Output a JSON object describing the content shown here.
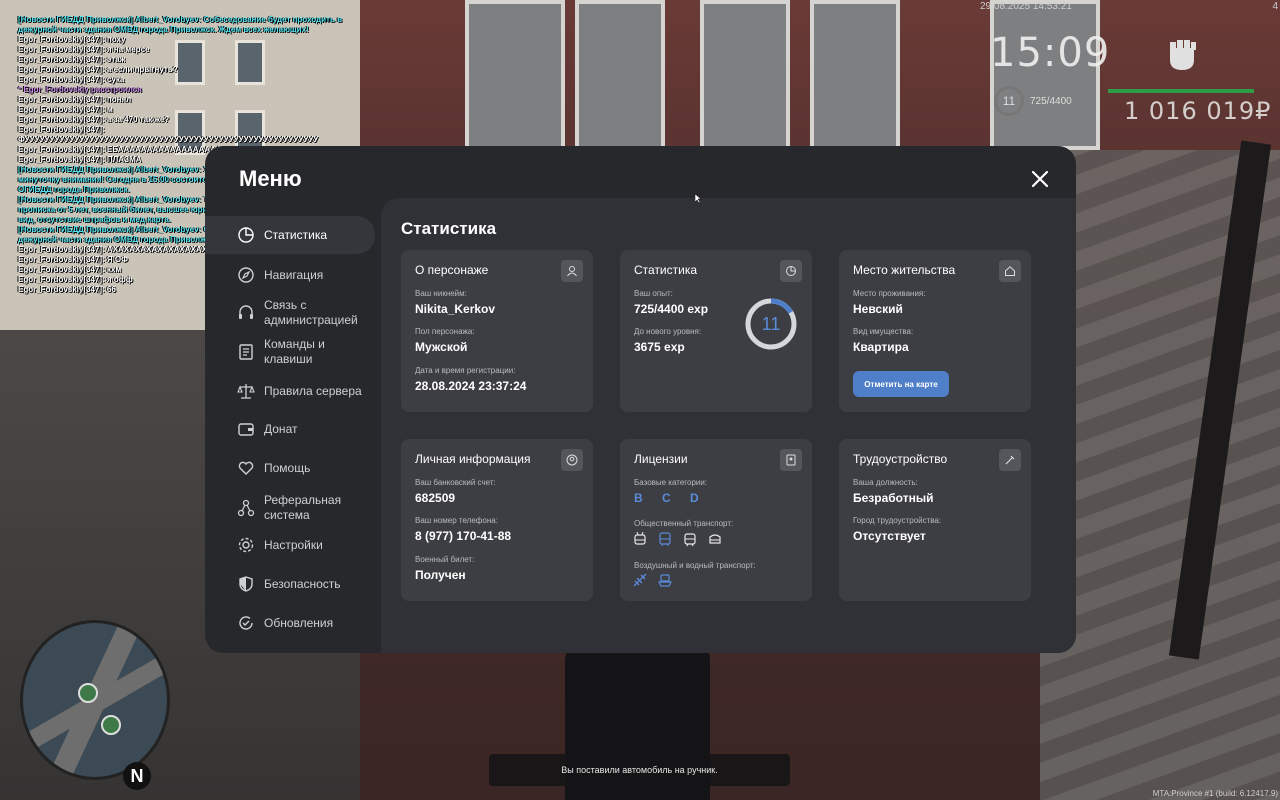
{
  "hud": {
    "datetime": "29.08.2025 14:53:21",
    "time": "15:09",
    "level": "11",
    "exp": "725/4400",
    "money": "1 016 019₽",
    "corner": "4"
  },
  "chat": [
    {
      "type": "news",
      "text": "[Новости ГИБДД Приволжск] Albert_Vorobyev: Собеседование будет проходить в дежурной части здания ОМВД города Приволжск. Ждем всех желающих!"
    },
    {
      "type": "normal",
      "text": "Egor_Fordovskiy[347]: поху"
    },
    {
      "type": "normal",
      "text": "Egor_Fordovskiy[347]: я на мерсе"
    },
    {
      "type": "normal",
      "text": "Egor_Fordovskiy[347]: этаж"
    },
    {
      "type": "normal",
      "text": "Egor_Fordovskiy[347]: а если прыгнуть?"
    },
    {
      "type": "normal",
      "text": "Egor_Fordovskiy[347]: сука"
    },
    {
      "type": "action",
      "text": "* Egor_Fordovskiy расстроился"
    },
    {
      "type": "normal",
      "text": "Egor_Fordovskiy[347]: понял"
    },
    {
      "type": "normal",
      "text": "Egor_Fordovskiy[347]: м"
    },
    {
      "type": "normal",
      "text": "Egor_Fordovskiy[347]: а за 470 так же?"
    },
    {
      "type": "normal",
      "text": "Egor_Fordovskiy[347]: ФУУУУУУУУУУУУУУУУУУУУУУУУУУУУУУУУУУУУУУУУУУУУУУУУУУУУУУУУУУУ"
    },
    {
      "type": "normal",
      "text": "Egor_Fordovskiy[347]: ЕБААААААААААААААААААААААТЬ"
    },
    {
      "type": "normal",
      "text": "Egor_Fordovskiy[347]: ПЛАЗМА"
    },
    {
      "type": "news",
      "text": "[Новости ГИБДД Приволжск] Albert_Vorobyev: Уважаемые жители республики, минуточку внимания! Сегодня в 15:00 состоится собеседование в УК ДПС ОГИБДД города Приволжск."
    },
    {
      "type": "news",
      "text": "[Новости ГИБДД Приволжск] Albert_Vorobyev: Требования к кандидатам: прописка от 5 лет, военный билет, высшее юридическое образование, опрятный вид, отсутствие штрафов и мед.карта."
    },
    {
      "type": "news",
      "text": "[Новости ГИБДД Приволжск] Albert_Vorobyev: Собеседование будет проходить в дежурной части здания ОМВД города Приволжск. Ждем всех желающих!"
    },
    {
      "type": "normal",
      "text": "Egor_Fordovskiy[347]: АХАХАХАХАХАХАХАХАХАХАХАХАХАХАХАХАХАХАХ"
    },
    {
      "type": "normal",
      "text": "Egor_Fordovskiy[347]: Я ОФ"
    },
    {
      "type": "normal",
      "text": "Egor_Fordovskiy[347]: кхм"
    },
    {
      "type": "normal",
      "text": "Egor_Fordovskiy[347]: я офф"
    },
    {
      "type": "normal",
      "text": "Egor_Fordovskiy[347]: 66"
    }
  ],
  "menu": {
    "title": "Меню",
    "sidebar": [
      {
        "label": "Статистика",
        "icon": "pie-chart-icon",
        "active": true
      },
      {
        "label": "Навигация",
        "icon": "compass-icon"
      },
      {
        "label": "Связь с администрацией",
        "icon": "headset-icon"
      },
      {
        "label": "Команды и клавиши",
        "icon": "document-icon"
      },
      {
        "label": "Правила сервера",
        "icon": "scales-icon"
      },
      {
        "label": "Донат",
        "icon": "wallet-icon"
      },
      {
        "label": "Помощь",
        "icon": "heart-hand-icon"
      },
      {
        "label": "Реферальная система",
        "icon": "network-icon"
      },
      {
        "label": "Настройки",
        "icon": "gear-icon"
      },
      {
        "label": "Безопасность",
        "icon": "shield-icon"
      },
      {
        "label": "Обновления",
        "icon": "refresh-icon"
      }
    ],
    "content_title": "Статистика",
    "cards": {
      "persona": {
        "title": "О персонаже",
        "nickname_label": "Ваш никнейм:",
        "nickname": "Nikita_Kerkov",
        "gender_label": "Пол персонажа:",
        "gender": "Мужской",
        "reg_label": "Дата и время регистрации:",
        "reg": "28.08.2024 23:37:24"
      },
      "stats": {
        "title": "Статистика",
        "exp_label": "Ваш опыт:",
        "exp": "725/4400 exp",
        "next_label": "До нового уровня:",
        "next": "3675 exp",
        "level": "11",
        "progress": 0.165
      },
      "residence": {
        "title": "Место жительства",
        "place_label": "Место проживания:",
        "place": "Невский",
        "property_label": "Вид имущества:",
        "property": "Квартира",
        "button": "Отметить на карте"
      },
      "personal": {
        "title": "Личная информация",
        "bank_label": "Ваш банковский счет:",
        "bank": "682509",
        "phone_label": "Ваш номер телефона:",
        "phone": "8 (977) 170-41-88",
        "military_label": "Военный билет:",
        "military": "Получен"
      },
      "licenses": {
        "title": "Лицензии",
        "base_label": "Базовые категории:",
        "base": "B C D",
        "public_label": "Общественный транспорт:",
        "public_icons": [
          "trolleybus-icon",
          "bus-icon",
          "tram-icon",
          "minibus-icon"
        ],
        "air_label": "Воздушный и водный транспорт:",
        "air_icons": [
          "plane-icon",
          "boat-icon"
        ]
      },
      "job": {
        "title": "Трудоустройство",
        "position_label": "Ваша должность:",
        "position": "Безработный",
        "city_label": "Город трудоустройства:",
        "city": "Отсутствует"
      }
    }
  },
  "notification": "Вы поставили автомобиль на ручник.",
  "build": "MTA:Province #1 (build: 6.12417.9)",
  "minimap": {
    "north": "N"
  },
  "colors": {
    "accent": "#4f7fc9",
    "panel": "#27282c",
    "card": "#3d3e43",
    "news": "#55e3f0"
  }
}
